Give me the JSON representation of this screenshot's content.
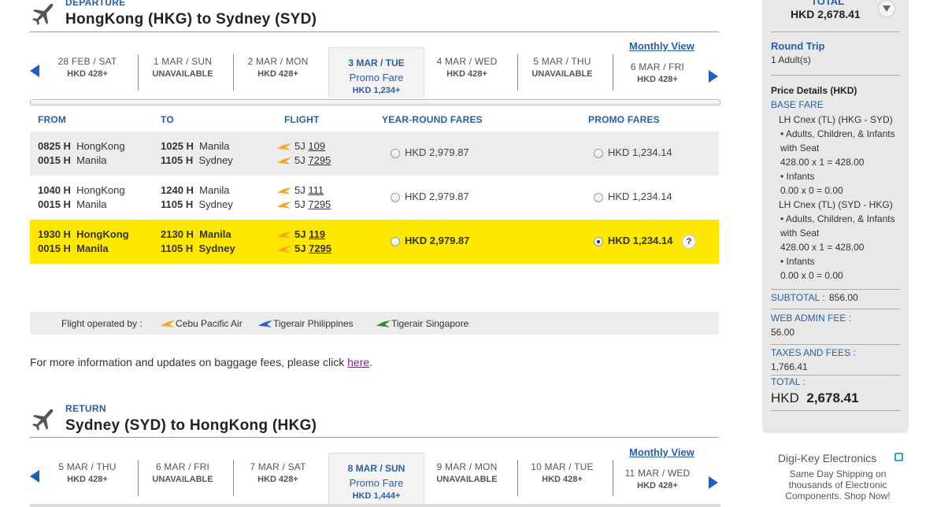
{
  "departure": {
    "label": "DEPARTURE",
    "title": "HongKong (HKG) to Sydney (SYD)",
    "monthly_view": "Monthly View",
    "dates": [
      {
        "date": "28 FEB / SAT",
        "price": "HKD 428+"
      },
      {
        "date": "1 MAR / SUN",
        "price": "UNAVAILABLE"
      },
      {
        "date": "2 MAR / MON",
        "price": "HKD 428+"
      },
      {
        "date": "3 MAR / TUE",
        "fare_label": "Promo Fare",
        "price": "HKD 1,234+",
        "selected": true
      },
      {
        "date": "4 MAR / WED",
        "price": "HKD 428+"
      },
      {
        "date": "5 MAR / THU",
        "price": "UNAVAILABLE"
      },
      {
        "date": "6 MAR / FRI",
        "price": "HKD 428+"
      }
    ],
    "columns": {
      "from": "FROM",
      "to": "TO",
      "flight": "FLIGHT",
      "year_round": "YEAR-ROUND FARES",
      "promo": "PROMO FARES"
    },
    "rows": [
      {
        "dep1_time": "0825 H",
        "dep1_city": "HongKong",
        "dep2_time": "0015 H",
        "dep2_city": "Manila",
        "arr1_time": "1025 H",
        "arr1_city": "Manila",
        "arr2_time": "1105 H",
        "arr2_city": "Sydney",
        "flight1_code": "5J",
        "flight1_num": "109",
        "flight2_code": "5J",
        "flight2_num": "7295",
        "year_round": "HKD 2,979.87",
        "promo": "HKD 1,234.14"
      },
      {
        "dep1_time": "1040 H",
        "dep1_city": "HongKong",
        "dep2_time": "0015 H",
        "dep2_city": "Manila",
        "arr1_time": "1240 H",
        "arr1_city": "Manila",
        "arr2_time": "1105 H",
        "arr2_city": "Sydney",
        "flight1_code": "5J",
        "flight1_num": "111",
        "flight2_code": "5J",
        "flight2_num": "7295",
        "year_round": "HKD 2,979.87",
        "promo": "HKD 1,234.14"
      },
      {
        "dep1_time": "1930 H",
        "dep1_city": "HongKong",
        "dep2_time": "0015 H",
        "dep2_city": "Manila",
        "arr1_time": "2130 H",
        "arr1_city": "Manila",
        "arr2_time": "1105 H",
        "arr2_city": "Sydney",
        "flight1_code": "5J",
        "flight1_num": "119",
        "flight2_code": "5J",
        "flight2_num": "7295",
        "year_round": "HKD 2,979.87",
        "promo": "HKD 1,234.14",
        "selected_fare": "promo"
      }
    ],
    "help": "?",
    "operated_by": {
      "label": "Flight operated by :",
      "carriers": [
        "Cebu Pacific Air",
        "Tigerair Philippines",
        "Tigerair Singapore"
      ]
    },
    "info_text": "For more information and updates on baggage fees, please click",
    "info_link": "here",
    "info_end": "."
  },
  "return": {
    "label": "RETURN",
    "title": "Sydney (SYD) to HongKong (HKG)",
    "monthly_view": "Monthly View",
    "dates": [
      {
        "date": "5 MAR / THU",
        "price": "HKD 428+"
      },
      {
        "date": "6 MAR / FRI",
        "price": "UNAVAILABLE"
      },
      {
        "date": "7 MAR / SAT",
        "price": "HKD 428+"
      },
      {
        "date": "8 MAR / SUN",
        "fare_label": "Promo Fare",
        "price": "HKD 1,444+",
        "selected": true
      },
      {
        "date": "9 MAR / MON",
        "price": "UNAVAILABLE"
      },
      {
        "date": "10 MAR / TUE",
        "price": "HKD 428+"
      },
      {
        "date": "11 MAR / WED",
        "price": "HKD 428+"
      }
    ]
  },
  "summary": {
    "total_top_label": "TOTAL",
    "total_top_value": "HKD 2,678.41",
    "trip_type": "Round Trip",
    "pax": "1 Adult(s)",
    "price_details_title": "Price Details (HKD)",
    "base_fare_label": "BASE FARE",
    "leg1_title": "LH Cnex (TL) (HKG - SYD)",
    "leg1_adults_label": "• Adults, Children, & Infants with Seat",
    "leg1_adults_calc": "428.00 x 1 = 428.00",
    "leg1_infants_label": "• Infants",
    "leg1_infants_calc": "0.00 x 0 = 0.00",
    "leg2_title": "LH Cnex (TL) (SYD - HKG)",
    "leg2_adults_label": "• Adults, Children, & Infants with Seat",
    "leg2_adults_calc": "428.00 x 1 = 428.00",
    "leg2_infants_label": "• Infants",
    "leg2_infants_calc": "0.00 x 0 = 0.00",
    "subtotal_label": "SUBTOTAL :",
    "subtotal_value": "856.00",
    "web_admin_label": "WEB ADMIN FEE :",
    "web_admin_value": "56.00",
    "taxes_label": "TAXES AND FEES :",
    "taxes_value": "1,766.41",
    "total_label": "TOTAL :",
    "total_currency": "HKD",
    "total_value": "2,678.41"
  },
  "ad": {
    "title": "Digi-Key Electronics",
    "line1": "Same Day Shipping on",
    "line2": "thousands of Electronic",
    "line3": "Components. Shop Now!"
  },
  "colors": {
    "accent_blue": "#2b5ea8",
    "highlight_yellow": "#ffe800",
    "cebu_orange": "#f5a623",
    "tiger_ph_blue": "#2a5bd7",
    "tiger_sg_green": "#2e8b2e"
  }
}
